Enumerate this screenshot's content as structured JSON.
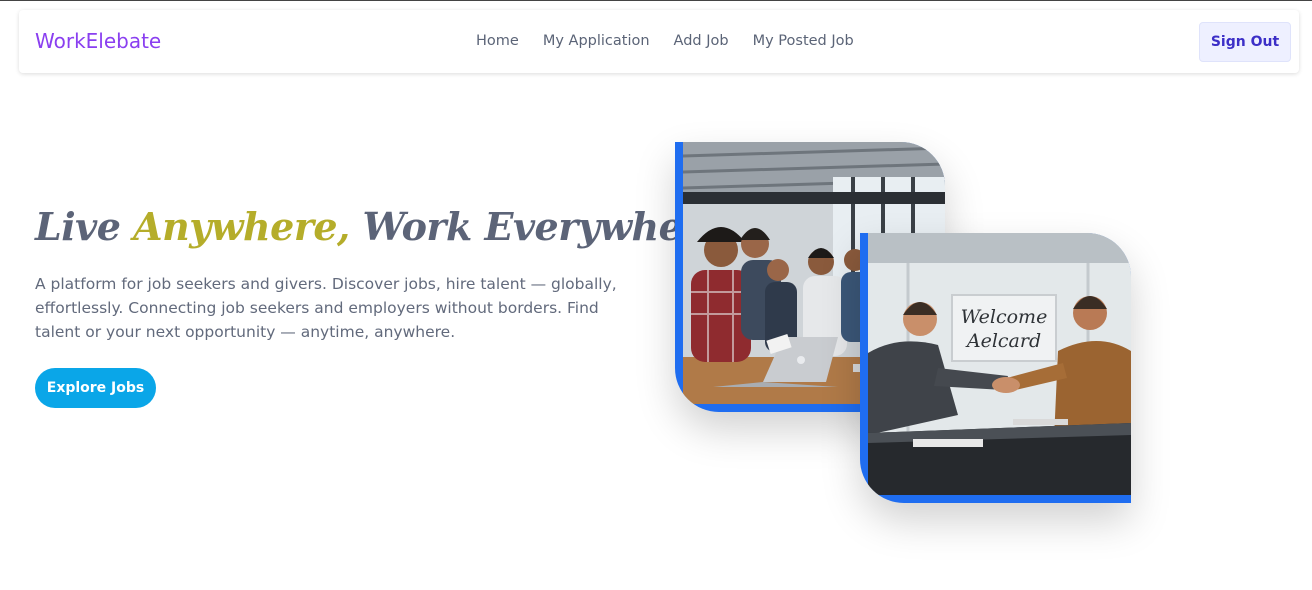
{
  "nav": {
    "brand": "WorkElebate",
    "links": [
      "Home",
      "My Application",
      "Add Job",
      "My Posted Job"
    ],
    "sign_out": "Sign Out"
  },
  "hero": {
    "headline_part1": "Live ",
    "headline_accent": "Anywhere,",
    "headline_part2": " Work Everywhere",
    "description": "A platform for job seekers and givers. Discover jobs, hire talent — globally, effortlessly. Connecting job seekers and employers without borders. Find talent or your next opportunity — anytime, anywhere.",
    "cta": "Explore Jobs"
  },
  "images": {
    "photo2_sign_line1": "Welcome",
    "photo2_sign_line2": "Aelcard"
  },
  "colors": {
    "brand": "#8a3ff0",
    "accent": "#b5ad2a",
    "cta": "#0aa6e8",
    "frame": "#1f6df0",
    "signout_text": "#3c2fc7"
  }
}
